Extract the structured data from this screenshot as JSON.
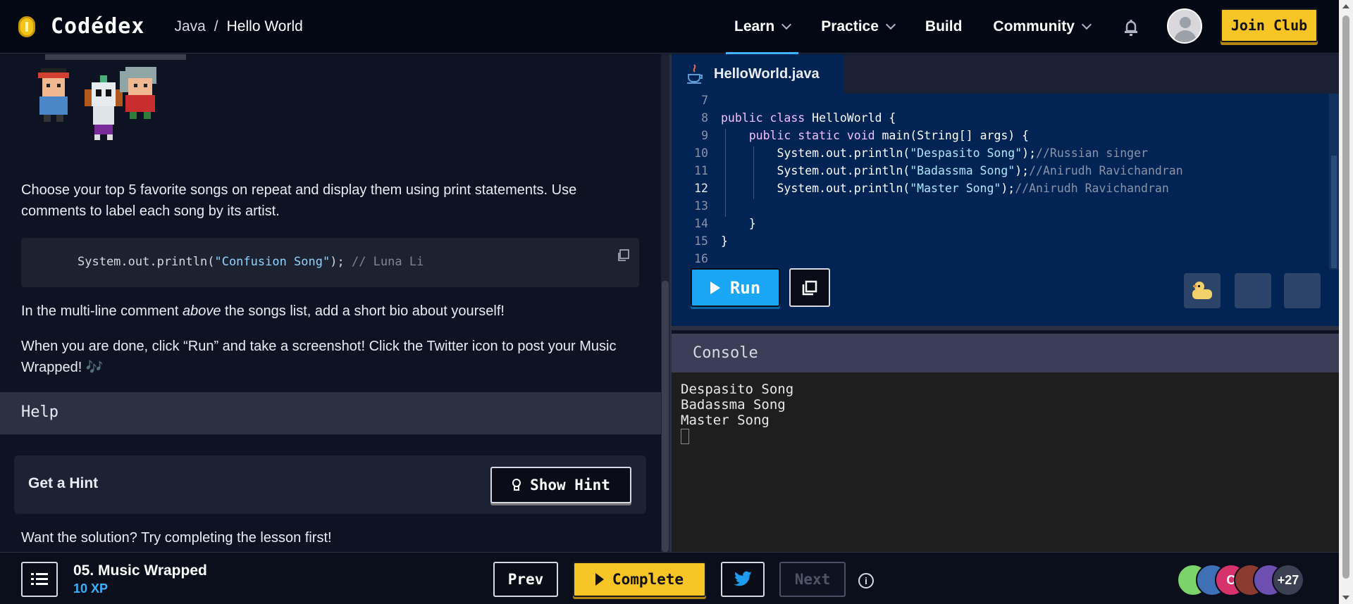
{
  "header": {
    "logo_text": "Codédex",
    "breadcrumb": {
      "language": "Java",
      "separator": "/",
      "page": "Hello World"
    },
    "nav": [
      {
        "label": "Learn",
        "has_dropdown": true,
        "active": true
      },
      {
        "label": "Practice",
        "has_dropdown": true,
        "active": false
      },
      {
        "label": "Build",
        "has_dropdown": false,
        "active": false
      },
      {
        "label": "Community",
        "has_dropdown": true,
        "active": false
      }
    ],
    "join_label": "Join Club"
  },
  "lesson": {
    "paragraph1": "Choose your top 5 favorite songs on repeat and display them using print statements. Use comments to label each song by its artist.",
    "example_code": {
      "prefix": "System.out.println(",
      "string": "\"Confusion Song\"",
      "suffix": "); ",
      "comment": "// Luna Li"
    },
    "paragraph2_before": "In the multi-line comment ",
    "paragraph2_em": "above",
    "paragraph2_after": " the songs list, add a short bio about yourself!",
    "paragraph3": "When you are done, click “Run” and take a screenshot! Click the Twitter icon to post your Music Wrapped! 🎶",
    "help_title": "Help",
    "hint_label": "Get a Hint",
    "show_hint_label": "Show Hint"
  },
  "solution_text": "Want the solution? Try completing the lesson first!",
  "editor": {
    "filename": "HelloWorld.java",
    "current_line": 12,
    "lines": [
      {
        "n": "7",
        "parts": []
      },
      {
        "n": "8",
        "parts": [
          [
            "k",
            "public class "
          ],
          [
            "t",
            "HelloWorld {"
          ]
        ]
      },
      {
        "n": "9",
        "parts": [
          [
            "t",
            "    "
          ],
          [
            "k",
            "public static void "
          ],
          [
            "t",
            "main(String[] args) {"
          ]
        ]
      },
      {
        "n": "10",
        "parts": [
          [
            "t",
            "        System.out.println("
          ],
          [
            "s",
            "\"Despasito Song\""
          ],
          [
            "t",
            ");"
          ],
          [
            "c",
            "//Russian singer"
          ]
        ]
      },
      {
        "n": "11",
        "parts": [
          [
            "t",
            "        System.out.println("
          ],
          [
            "s",
            "\"Badassma Song\""
          ],
          [
            "t",
            ");"
          ],
          [
            "c",
            "//Anirudh Ravichandran"
          ]
        ]
      },
      {
        "n": "12",
        "parts": [
          [
            "t",
            "        System.out.println("
          ],
          [
            "s",
            "\"Master Song\""
          ],
          [
            "t",
            ");"
          ],
          [
            "c",
            "//Anirudh Ravichandran"
          ]
        ]
      },
      {
        "n": "13",
        "parts": []
      },
      {
        "n": "14",
        "parts": [
          [
            "t",
            "    }"
          ]
        ]
      },
      {
        "n": "15",
        "parts": [
          [
            "t",
            "}"
          ]
        ]
      },
      {
        "n": "16",
        "parts": []
      }
    ],
    "run_label": "Run"
  },
  "console": {
    "title": "Console",
    "output": [
      "Despasito Song",
      "Badassma Song",
      "Master Song"
    ]
  },
  "footer": {
    "lesson_title": "05. Music Wrapped",
    "xp": "10 XP",
    "prev_label": "Prev",
    "complete_label": "Complete",
    "next_label": "Next",
    "info": "i",
    "avatars": [
      {
        "label": "",
        "color": "#7bd36a"
      },
      {
        "label": "",
        "color": "#3f6fb5"
      },
      {
        "label": "C",
        "color": "#d6336c"
      },
      {
        "label": "",
        "color": "#8a3b2f"
      },
      {
        "label": "",
        "color": "#6c4fb0"
      },
      {
        "label": "+27",
        "color": "#3a4152"
      }
    ]
  },
  "colors": {
    "accent_blue": "#18a6f5",
    "accent_yellow": "#f7c525",
    "editor_bg": "#012454",
    "page_bg": "#0e1323"
  }
}
